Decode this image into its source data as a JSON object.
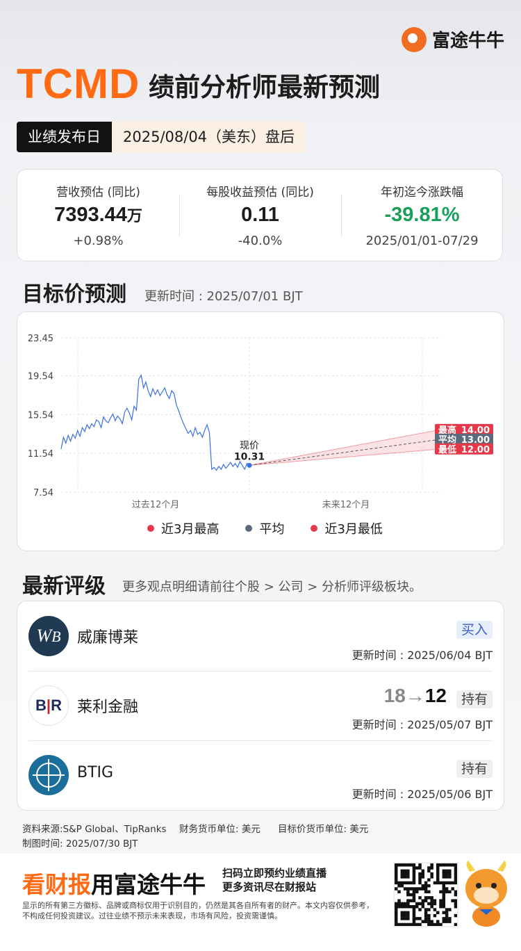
{
  "brand": {
    "name": "富途牛牛"
  },
  "header": {
    "ticker": "TCMD",
    "title": "绩前分析师最新预测"
  },
  "release": {
    "label": "业绩发布日",
    "value": "2025/08/04（美东）盘后"
  },
  "metrics": [
    {
      "label": "营收预估 (同比)",
      "value": "7393.44",
      "unit": "万",
      "sub": "+0.98%"
    },
    {
      "label": "每股收益预估 (同比)",
      "value": "0.11",
      "unit": "",
      "sub": "-40.0%"
    },
    {
      "label": "年初迄今涨跌幅",
      "value": "-39.81%",
      "unit": "",
      "sub": "2025/01/01-07/29"
    }
  ],
  "colors": {
    "accent": "#ff6a13",
    "up": "#1a9e5c",
    "high": "#e5394a",
    "avg": "#5b6b7e",
    "low": "#e5394a",
    "line": "#3a6fe0"
  },
  "target": {
    "title": "目标价预测",
    "updated": "更新时间 : 2025/07/01 BJT",
    "current_label": "现价",
    "current_value": "10.31",
    "past_label": "过去12个月",
    "future_label": "未来12个月",
    "legend": [
      "近3月最高",
      "平均",
      "近3月最低"
    ],
    "bands": [
      {
        "label": "最高",
        "value": "14.00"
      },
      {
        "label": "平均",
        "value": "13.00"
      },
      {
        "label": "最低",
        "value": "12.00"
      }
    ]
  },
  "chart_data": {
    "type": "line",
    "yticks": [
      "23.45",
      "19.54",
      "15.54",
      "11.54",
      "7.54"
    ],
    "ylim": [
      7.54,
      23.45
    ],
    "grid": true,
    "price_series": [
      12.0,
      13.2,
      12.6,
      13.4,
      12.8,
      13.5,
      13.1,
      13.9,
      13.3,
      14.2,
      13.8,
      14.5,
      14.1,
      14.6,
      14.3,
      15.0,
      14.8,
      14.2,
      15.3,
      14.9,
      14.7,
      15.2,
      15.6,
      14.9,
      15.4,
      15.1,
      14.6,
      15.8,
      16.2,
      15.7,
      15.0,
      16.4,
      16.0,
      19.2,
      19.6,
      18.3,
      18.9,
      18.0,
      17.4,
      18.2,
      17.6,
      18.1,
      17.5,
      17.9,
      18.3,
      17.6,
      17.2,
      18.0,
      17.7,
      16.5,
      15.9,
      15.2,
      14.6,
      14.1,
      13.6,
      13.9,
      13.3,
      14.2,
      13.5,
      13.7,
      13.2,
      13.9,
      14.5,
      13.7,
      9.9,
      10.1,
      9.8,
      10.2,
      9.9,
      10.4,
      10.0,
      10.3,
      10.6,
      10.2,
      10.5,
      10.1,
      10.7,
      10.3,
      9.9,
      10.5,
      10.31
    ],
    "current": 10.31,
    "forecast": {
      "high": 14.0,
      "avg": 13.0,
      "low": 12.0
    }
  },
  "ratings": {
    "title": "最新评级",
    "sub": "更多观点明细请前往个股 > 公司 > 分析师评级板块。",
    "items": [
      {
        "name": "威廉博莱",
        "logo_text": "WB",
        "rating": "买入",
        "updated": "更新时间 : 2025/06/04 BJT",
        "from": "",
        "arrow": "",
        "to": ""
      },
      {
        "name": "莱利金融",
        "logo_text": "B|R",
        "rating": "持有",
        "updated": "更新时间 : 2025/05/07 BJT",
        "from": "18",
        "arrow": "→",
        "to": "12"
      },
      {
        "name": "BTIG",
        "logo_text": "",
        "rating": "持有",
        "updated": "更新时间 : 2025/05/06 BJT",
        "from": "",
        "arrow": "",
        "to": ""
      }
    ]
  },
  "footer": {
    "source": "资料来源:S&P Global、TipRanks",
    "fin_currency": "财务货币单位: 美元",
    "target_currency": "目标价货币单位: 美元",
    "made": "制图时间: 2025/07/30 BJT",
    "promo_a": "看财报",
    "promo_b": "用富途牛牛",
    "scan1": "扫码立即预约业绩直播",
    "scan2": "更多资讯尽在财报站",
    "disclaimer": "显示的所有第三方徽标、品牌或商标仅用于识别目的，仍然是其各自所有者的财产。本文内容仅供参考，不构成任何投资建议。过往业绩不预示未来表现，市场有风险，投资需谨慎。"
  }
}
